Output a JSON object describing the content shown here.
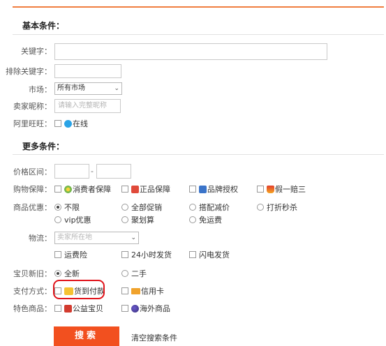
{
  "basic": {
    "title": "基本条件：",
    "keyword_label": "关键字：",
    "exclude_label": "排除关键字：",
    "market_label": "市场：",
    "market_value": "所有市场",
    "seller_label": "卖家昵称：",
    "seller_placeholder": "请输入完整昵称",
    "wangwang_label": "阿里旺旺：",
    "online_label": "在线"
  },
  "more": {
    "title": "更多条件：",
    "price_label": "价格区间：",
    "price_dash": "-",
    "guarantee_label": "购物保障：",
    "guarantee": [
      "消费者保障",
      "正品保障",
      "品牌授权",
      "假一赔三"
    ],
    "promo_label": "商品优惠：",
    "promo": [
      "不限",
      "全部促销",
      "搭配减价",
      "打折秒杀",
      "vip优惠",
      "聚划算",
      "免运费"
    ],
    "promo_selected": "不限",
    "logistics_label": "物流：",
    "logistics_placeholder": "卖家所在地",
    "logistics": [
      "运费险",
      "24小时发货",
      "闪电发货"
    ],
    "condition_label": "宝贝新旧：",
    "condition": [
      "全新",
      "二手"
    ],
    "condition_selected": "全新",
    "payment_label": "支付方式：",
    "payment": [
      "货到付款",
      "信用卡"
    ],
    "special_label": "特色商品：",
    "special": [
      "公益宝贝",
      "海外商品"
    ]
  },
  "actions": {
    "search_button": "搜索",
    "clear_link": "清空搜索条件"
  },
  "colors": {
    "accent": "#f07e3f",
    "button": "#f2501f",
    "highlight_circle": "#e0131a"
  }
}
